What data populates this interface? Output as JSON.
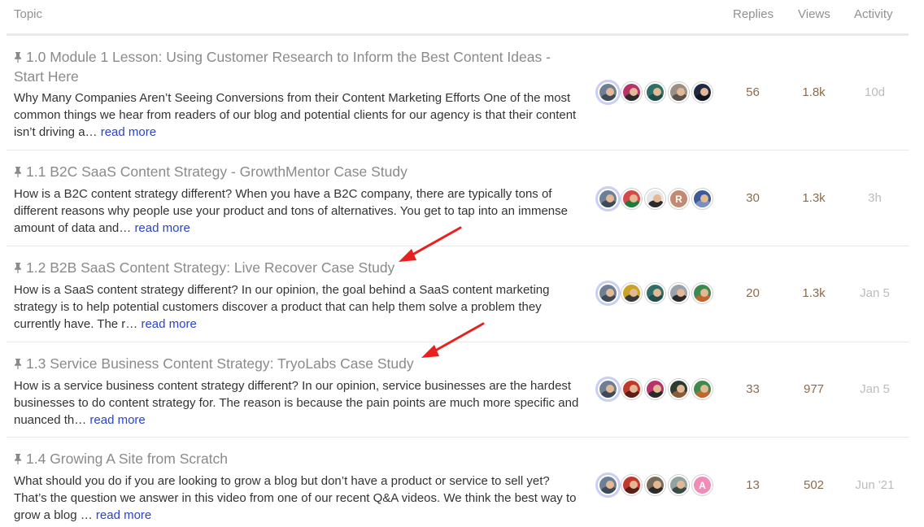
{
  "columns": {
    "topic": "Topic",
    "replies": "Replies",
    "views": "Views",
    "activity": "Activity"
  },
  "read_more_label": "read more",
  "topics": [
    {
      "title": "1.0 Module 1 Lesson: Using Customer Research to Inform the Best Content Ideas - Start Here",
      "excerpt": "Why Many Companies Aren’t Seeing Conversions from their Content Marketing Efforts One of the most common things we hear from readers of our blog and potential clients for our agency is that their content isn’t driving a… ",
      "replies": "56",
      "views": "1.8k",
      "activity": "10d",
      "posters": [
        {
          "kind": "photo",
          "bg": "#6f7f93",
          "shirt": "#3d4a5c"
        },
        {
          "kind": "photo",
          "bg": "#b8336a",
          "shirt": "#2b2b2b"
        },
        {
          "kind": "photo",
          "bg": "#2f6f6a",
          "shirt": "#1f4f4b"
        },
        {
          "kind": "photo",
          "bg": "#9a8f85",
          "shirt": "#5a524c"
        },
        {
          "kind": "photo",
          "bg": "#1f2a44",
          "shirt": "#101626"
        }
      ]
    },
    {
      "title": "1.1 B2C SaaS Content Strategy - GrowthMentor Case Study",
      "excerpt": "How is a B2C content strategy different? When you have a B2C company, there are typically tons of different reasons why people use your product and tons of alternatives. You get to tap into an immense amount of data and… ",
      "replies": "30",
      "views": "1.3k",
      "activity": "3h",
      "posters": [
        {
          "kind": "photo",
          "bg": "#6f7f93",
          "shirt": "#3d4a5c"
        },
        {
          "kind": "photo",
          "bg": "#d64a4a",
          "shirt": "#1f7a3e"
        },
        {
          "kind": "photo",
          "bg": "#e6e6e6",
          "shirt": "#2b2b2b"
        },
        {
          "kind": "letter",
          "letter": "R",
          "bg": "#c08a73"
        },
        {
          "kind": "photo",
          "bg": "#3b5a9a",
          "shirt": "#7a8fc2"
        }
      ]
    },
    {
      "title": "1.2 B2B SaaS Content Strategy: Live Recover Case Study",
      "excerpt": "How is a SaaS content strategy different? In our opinion, the goal behind a SaaS content marketing strategy is to help potential customers discover a product that can help them solve a problem they currently have. The r… ",
      "replies": "20",
      "views": "1.3k",
      "activity": "Jan 5",
      "posters": [
        {
          "kind": "photo",
          "bg": "#6f7f93",
          "shirt": "#3d4a5c"
        },
        {
          "kind": "photo",
          "bg": "#c9a227",
          "shirt": "#3a3a3a"
        },
        {
          "kind": "photo",
          "bg": "#2f6f6a",
          "shirt": "#1f4f4b"
        },
        {
          "kind": "photo",
          "bg": "#9aa3ad",
          "shirt": "#2b2b2b"
        },
        {
          "kind": "photo",
          "bg": "#3c8a4e",
          "shirt": "#c0672e"
        }
      ]
    },
    {
      "title": "1.3 Service Business Content Strategy: TryoLabs Case Study",
      "excerpt": "How is a service business content strategy different? In our opinion, service businesses are the hardest businesses to do content strategy for. The reason is because the pain points are much more specific and nuanced th… ",
      "replies": "33",
      "views": "977",
      "activity": "Jan 5",
      "posters": [
        {
          "kind": "photo",
          "bg": "#6f7f93",
          "shirt": "#3d4a5c"
        },
        {
          "kind": "photo",
          "bg": "#c0392b",
          "shirt": "#5a1f1a"
        },
        {
          "kind": "photo",
          "bg": "#b8336a",
          "shirt": "#2b2b2b"
        },
        {
          "kind": "photo",
          "bg": "#2e3b2f",
          "shirt": "#8a5a3a"
        },
        {
          "kind": "photo",
          "bg": "#3c8a4e",
          "shirt": "#c0672e"
        }
      ]
    },
    {
      "title": "1.4 Growing A Site from Scratch",
      "excerpt": "What should you do if you are looking to grow a blog but don’t have a product or service to sell yet? That’s the question we answer in this video from one of our recent Q&A videos. We think the best way to grow a blog … ",
      "replies": "13",
      "views": "502",
      "activity": "Jun '21",
      "posters": [
        {
          "kind": "photo",
          "bg": "#6f7f93",
          "shirt": "#3d4a5c"
        },
        {
          "kind": "photo",
          "bg": "#c0392b",
          "shirt": "#5a1f1a"
        },
        {
          "kind": "photo",
          "bg": "#7a6a5a",
          "shirt": "#2b2b2b"
        },
        {
          "kind": "photo",
          "bg": "#8fa3a0",
          "shirt": "#3a4a48"
        },
        {
          "kind": "letter",
          "letter": "A",
          "bg": "#f28bb8"
        }
      ]
    }
  ],
  "colors": {
    "accent_link": "#2b44c6",
    "annotation_arrow": "#e8201f"
  }
}
